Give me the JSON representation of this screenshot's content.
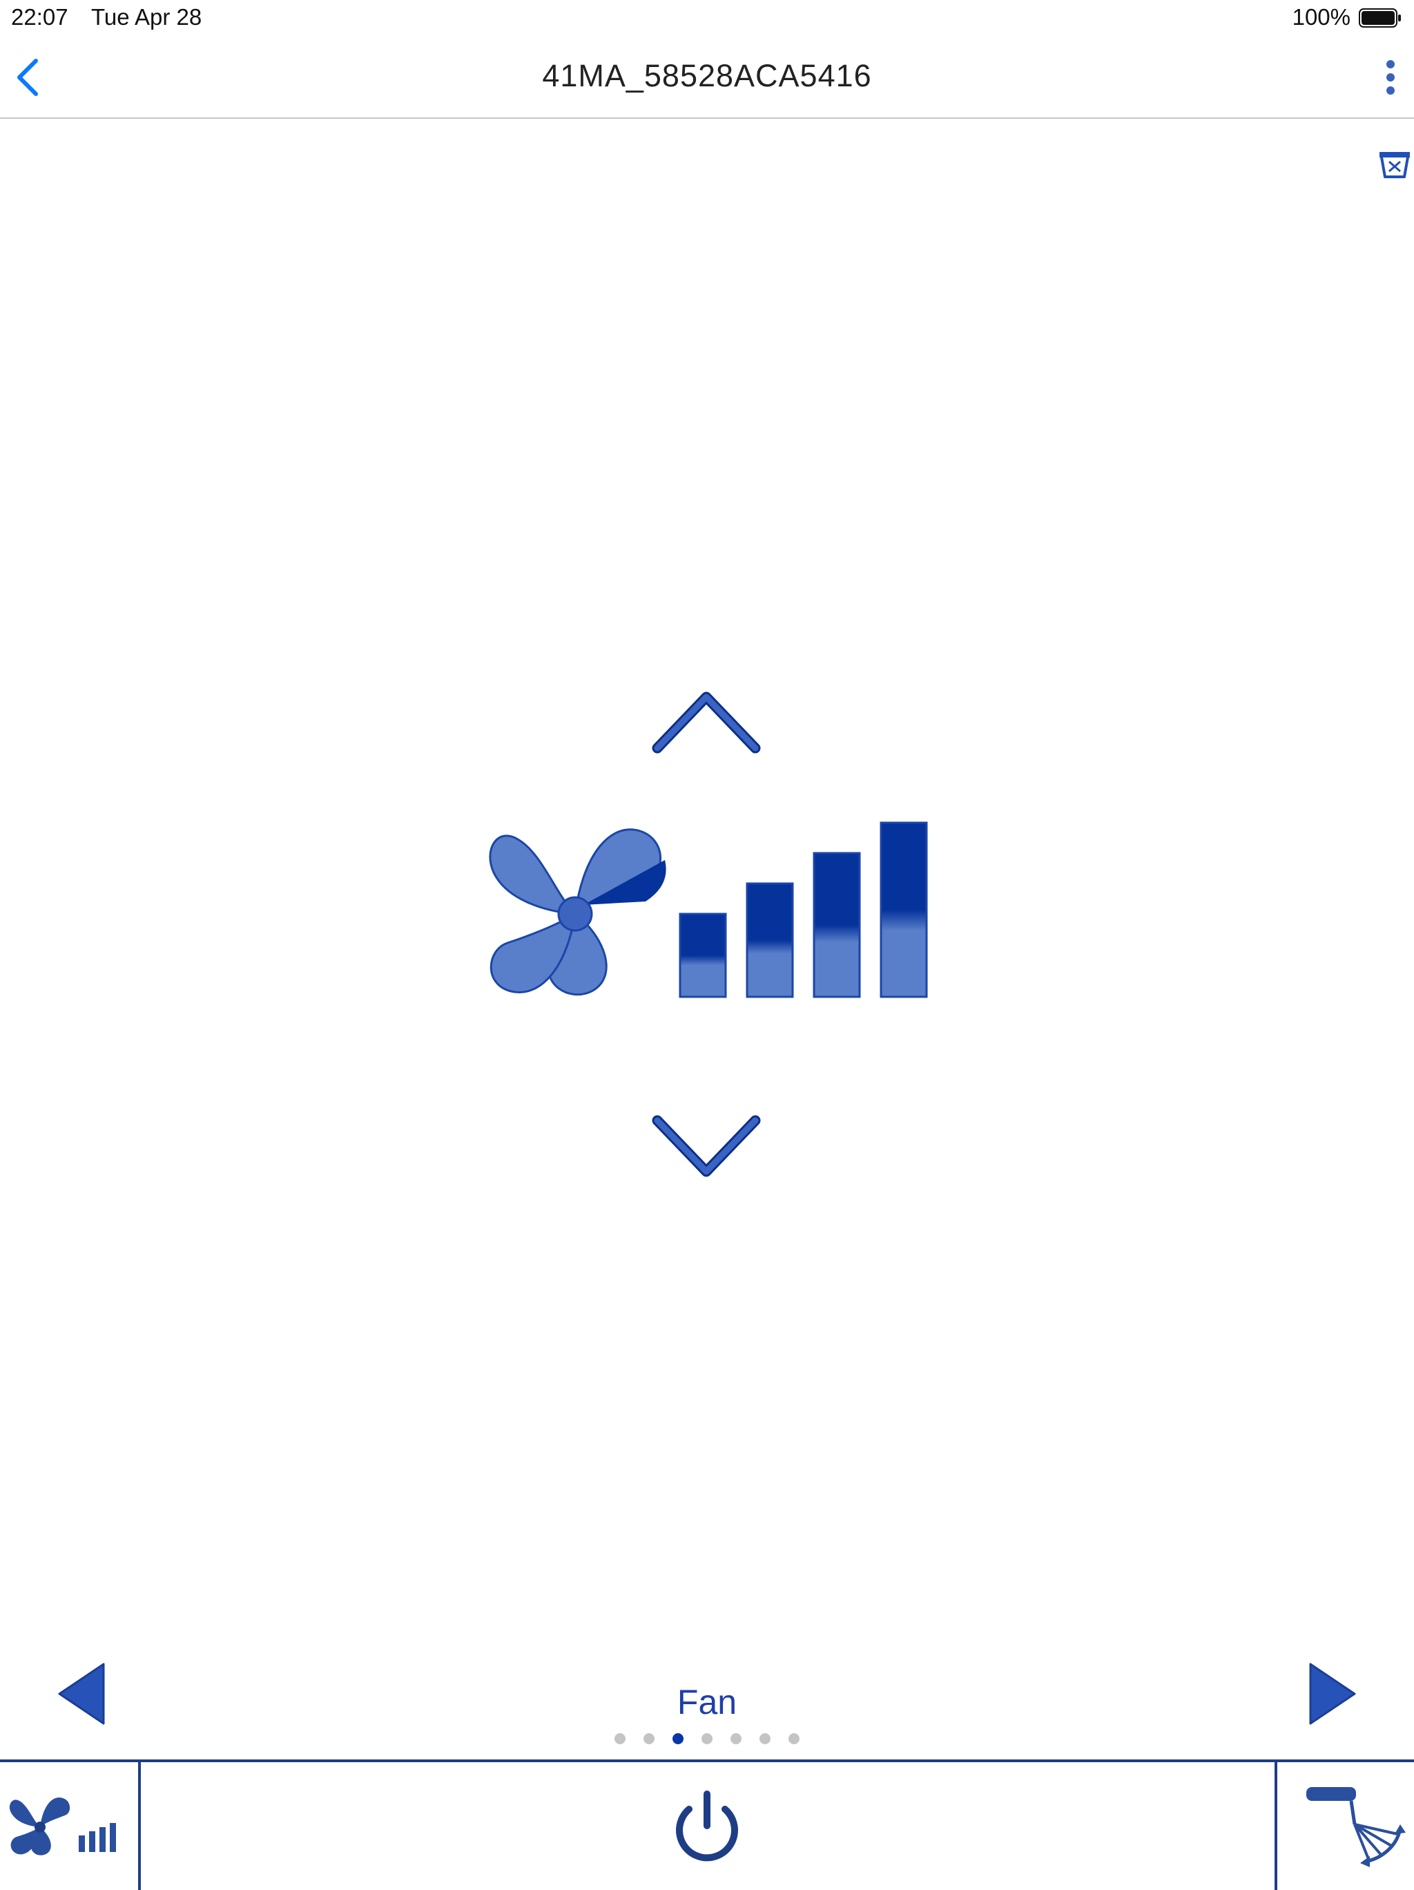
{
  "status_bar": {
    "time": "22:07",
    "date": "Tue Apr 28",
    "battery": "100%"
  },
  "header": {
    "title": "41MA_58528ACA5416",
    "back_icon": "chevron-left-icon",
    "menu_icon": "vertical-ellipsis-icon"
  },
  "indicators": {
    "filter_icon": "filter-icon"
  },
  "fan_control": {
    "up_icon": "chevron-up-icon",
    "down_icon": "chevron-down-icon",
    "fan_speed_icon": "fan-speed-icon",
    "speed_bars": 4
  },
  "mode_selector": {
    "label": "Fan",
    "prev_icon": "triangle-left-icon",
    "next_icon": "triangle-right-icon",
    "page_count": 7,
    "active_page": 3
  },
  "bottom_bar": {
    "left_icon": "fan-speed-icon",
    "center_icon": "power-icon",
    "right_icon": "swing-icon"
  },
  "colors": {
    "accent": "#1f3fa8",
    "ios_blue": "#0a7aff",
    "fan_light": "#5a7fca",
    "fan_dark": "#05339b",
    "bar_border": "#1f3d84"
  }
}
